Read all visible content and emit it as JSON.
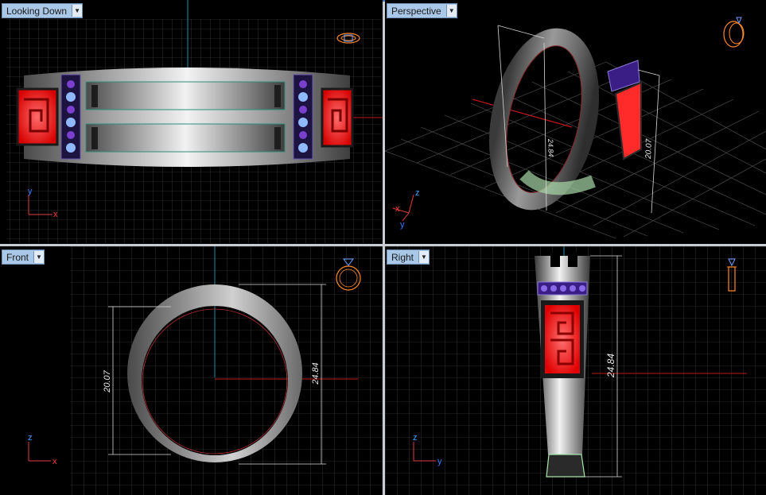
{
  "viewports": {
    "top": {
      "label": "Looking Down",
      "axes": {
        "v": "y",
        "h": "x"
      }
    },
    "perspective": {
      "label": "Perspective",
      "axes": {
        "v": "z",
        "h": "x",
        "d": "y"
      },
      "dims": {
        "height": "24.84",
        "width": "20.07"
      }
    },
    "front": {
      "label": "Front",
      "axes": {
        "v": "z",
        "h": "x"
      },
      "dims": {
        "inner": "20.07",
        "outer": "24.84"
      }
    },
    "right": {
      "label": "Right",
      "axes": {
        "v": "z",
        "h": "y"
      },
      "dims": {
        "height": "24.84"
      }
    }
  },
  "colors": {
    "viewport_bg": "#000000",
    "grid": "#5a5a5a",
    "label_bg": "#a9c7e6",
    "accent_red": "#ff2a2a",
    "gem_purple": "#7b3fd0",
    "gem_blue": "#8fb8ff",
    "metal": "#b9b9b9"
  },
  "icons": [
    "dropdown-arrow-icon",
    "ring-orientation-icon",
    "axis-gizmo-icon"
  ]
}
